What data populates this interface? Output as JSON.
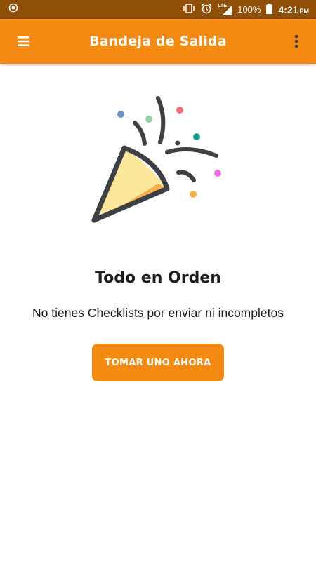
{
  "status_bar": {
    "battery": "100%",
    "time": "4:21",
    "ampm": "PM",
    "network": "LTE",
    "icons": [
      "app-notification-icon",
      "vibrate-icon",
      "alarm-icon",
      "lte-signal-icon",
      "battery-icon"
    ]
  },
  "app_bar": {
    "title": "Bandeja de Salida",
    "menu_icon": "hamburger-menu-icon",
    "overflow_icon": "more-vert-icon"
  },
  "empty_state": {
    "illustration": "party-popper-icon",
    "title": "Todo en Orden",
    "message": "No tienes Checklists por enviar ni incompletos",
    "button_label": "TOMAR UNO AHORA"
  },
  "colors": {
    "primary": "#f58a13",
    "status_bar": "#8f4f07",
    "text": "#1c1c1c",
    "background": "#ffffff"
  }
}
